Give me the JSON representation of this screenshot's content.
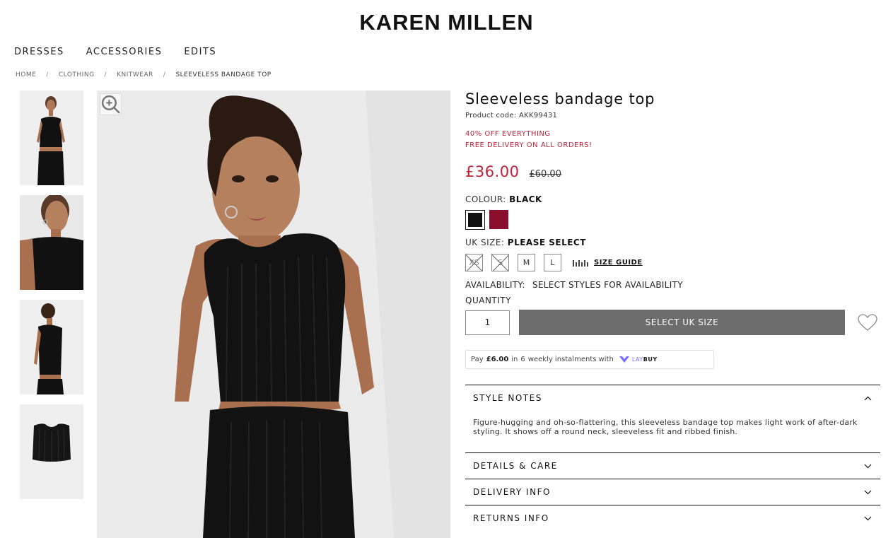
{
  "brand": {
    "logo_text": "KAREN MILLEN"
  },
  "nav": [
    {
      "label": "DRESSES"
    },
    {
      "label": "ACCESSORIES"
    },
    {
      "label": "EDITS"
    }
  ],
  "breadcrumb": [
    {
      "label": "HOME"
    },
    {
      "label": "CLOTHING"
    },
    {
      "label": "KNITWEAR"
    },
    {
      "label": "SLEEVELESS BANDAGE TOP"
    }
  ],
  "breadcrumb_separator": "/",
  "product": {
    "title": "Sleeveless bandage top",
    "code_label": "Product code:",
    "code": "AKK99431",
    "promos": [
      "40% OFF EVERYTHING",
      "FREE DELIVERY ON ALL ORDERS!"
    ],
    "price": "£36.00",
    "was_price": "£60.00",
    "colour_label": "COLOUR:",
    "colour_value": "BLACK",
    "swatches": [
      {
        "name": "black",
        "color": "#111111"
      },
      {
        "name": "burgundy",
        "color": "#8a0f2e"
      }
    ],
    "size_label": "UK SIZE:",
    "size_value": "PLEASE SELECT",
    "sizes": [
      {
        "label": "XS",
        "available": false
      },
      {
        "label": "S",
        "available": false
      },
      {
        "label": "M",
        "available": true
      },
      {
        "label": "L",
        "available": true
      }
    ],
    "size_guide": "SIZE GUIDE",
    "availability_label": "AVAILABILITY:",
    "availability_value": "SELECT STYLES FOR AVAILABILITY",
    "quantity_label": "QUANTITY",
    "quantity_value": "1",
    "add_button": "SELECT UK SIZE",
    "laybuy": {
      "prefix": "Pay",
      "amount": "£6.00",
      "middle": "in",
      "count": "6",
      "suffix": "weekly instalments with",
      "brand_light": "LAY",
      "brand_bold": "BUY"
    },
    "accordions": [
      {
        "title": "STYLE NOTES",
        "open": true,
        "body": "Figure-hugging and oh-so-flattering, this sleeveless bandage top makes light work of after-dark styling. It shows off a round neck, sleeveless fit and ribbed finish."
      },
      {
        "title": "DETAILS & CARE",
        "open": false
      },
      {
        "title": "DELIVERY INFO",
        "open": false
      },
      {
        "title": "RETURNS INFO",
        "open": false
      }
    ]
  },
  "colors": {
    "accent_red": "#c0213a",
    "button_grey": "#6d6d6d",
    "laybuy_purple": "#786dff"
  }
}
